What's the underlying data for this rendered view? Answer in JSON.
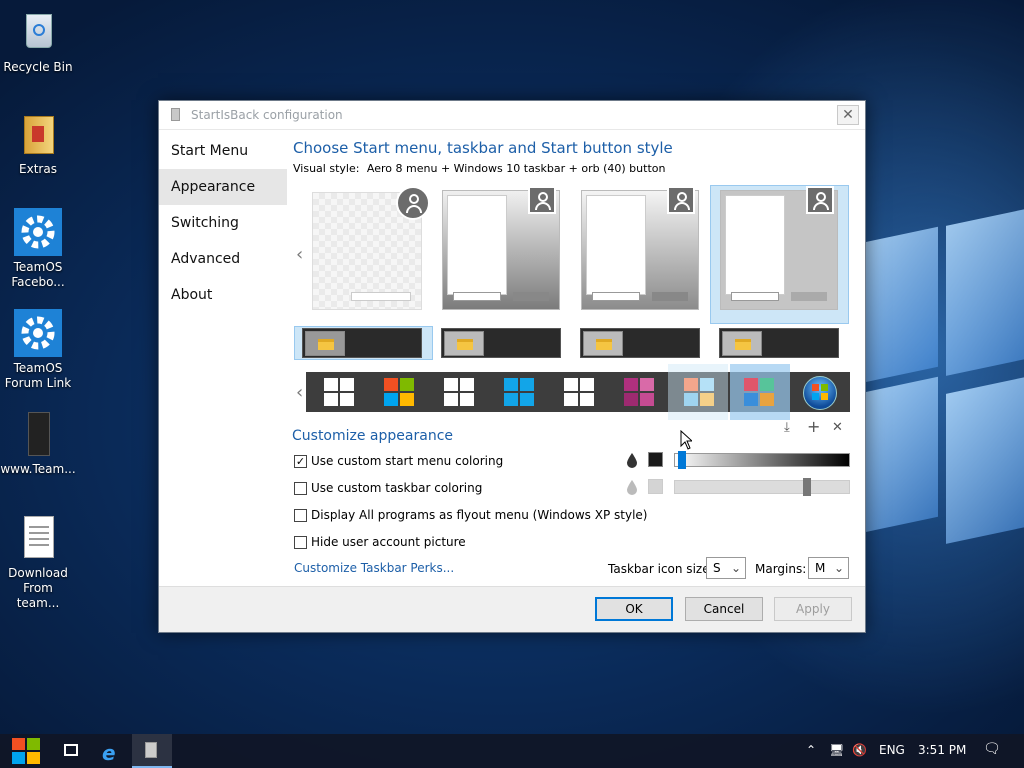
{
  "desktop": {
    "icons": [
      {
        "label": "Recycle Bin"
      },
      {
        "label": "Extras"
      },
      {
        "label": "TeamOS Facebo..."
      },
      {
        "label": "TeamOS Forum Link"
      },
      {
        "label": "www.Team..."
      },
      {
        "label": "Download From team..."
      }
    ]
  },
  "dialog": {
    "title": "StartIsBack configuration",
    "close": "✕",
    "nav": [
      "Start Menu",
      "Appearance",
      "Switching",
      "Advanced",
      "About"
    ],
    "active_nav": "Appearance",
    "style_heading": "Choose Start menu, taskbar and Start button style",
    "visual_style_label": "Visual style:",
    "visual_style_value": "Aero 8 menu + Windows 10 taskbar + orb (40) button",
    "customize_heading": "Customize appearance",
    "checkboxes": [
      {
        "label": "Use custom start menu coloring",
        "checked": true
      },
      {
        "label": "Use custom taskbar coloring",
        "checked": false
      },
      {
        "label": "Display All programs as flyout menu (Windows XP style)",
        "checked": false
      },
      {
        "label": "Hide user account picture",
        "checked": false
      }
    ],
    "perks_link": "Customize Taskbar Perks...",
    "icon_size_label": "Taskbar icon size:",
    "icon_size_value": "S",
    "margins_label": "Margins:",
    "margins_value": "M",
    "ok": "OK",
    "cancel": "Cancel",
    "apply": "Apply",
    "menu_color_level": 0.02,
    "taskbar_color_level": 0.76,
    "colors": {
      "accent": "#1d5fa8",
      "selection": "#cde6f7"
    }
  },
  "taskbar": {
    "lang": "ENG",
    "time": "3:51 PM"
  }
}
